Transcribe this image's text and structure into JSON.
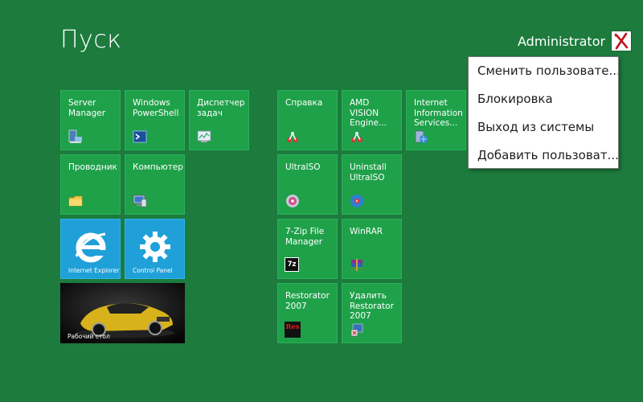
{
  "header": {
    "title": "Пуск"
  },
  "user": {
    "name": "Administrator",
    "avatar_icon": "red-x-logo-icon"
  },
  "user_menu": {
    "items": [
      {
        "label": "Сменить пользовате..."
      },
      {
        "label": "Блокировка"
      },
      {
        "label": "Выход из системы"
      },
      {
        "label": "Добавить пользоват..."
      }
    ]
  },
  "tiles": {
    "server_manager": {
      "label": "Server Manager",
      "icon": "server-manager-icon"
    },
    "powershell": {
      "label": "Windows PowerShell",
      "icon": "powershell-icon"
    },
    "task_manager": {
      "label": "Диспетчер задач",
      "icon": "task-manager-icon"
    },
    "explorer": {
      "label": "Проводник",
      "icon": "folder-icon"
    },
    "computer": {
      "label": "Компьютер",
      "icon": "computer-icon"
    },
    "ie": {
      "label": "Internet Explorer",
      "icon": "internet-explorer-icon"
    },
    "control_panel": {
      "label": "Control Panel",
      "icon": "gear-icon"
    },
    "desktop": {
      "label": "Рабочий стол"
    },
    "help": {
      "label": "Справка",
      "icon": "help-icon"
    },
    "amd": {
      "label": "AMD VISION Engine...",
      "icon": "amd-icon"
    },
    "iis": {
      "label": "Internet Information Services...",
      "icon": "iis-icon"
    },
    "ultraiso": {
      "label": "UltraISO",
      "icon": "ultraiso-icon"
    },
    "uninstall_ultraiso": {
      "label": "Uninstall UltraISO",
      "icon": "uninstall-icon"
    },
    "sevenzip": {
      "label": "7-Zip File Manager",
      "icon": "7zip-icon",
      "icon_text": "7z"
    },
    "winrar": {
      "label": "WinRAR",
      "icon": "winrar-icon"
    },
    "restorator": {
      "label": "Restorator 2007",
      "icon": "restorator-icon",
      "icon_text": "Res"
    },
    "remove_restorator": {
      "label": "Удалить Restorator 2007",
      "icon": "uninstall-restorator-icon"
    }
  },
  "colors": {
    "background": "#1c7b3d",
    "tile_green": "#1fa14a",
    "tile_blue": "#1fa0d8"
  }
}
